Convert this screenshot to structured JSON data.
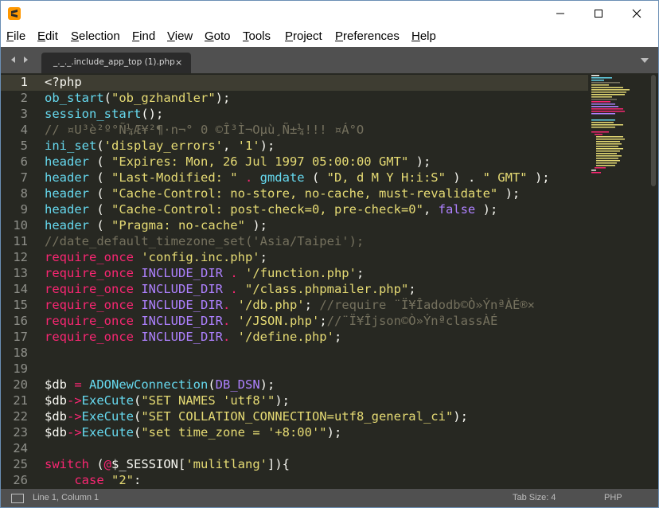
{
  "titlebar": {
    "icon": "sublime-text-icon",
    "controls": [
      "minimize-icon",
      "maximize-icon",
      "close-icon"
    ]
  },
  "menu": [
    "File",
    "Edit",
    "Selection",
    "Find",
    "View",
    "Goto",
    "Tools",
    "Project",
    "Preferences",
    "Help"
  ],
  "tab": {
    "label": "_._._.include_app_top (1).php",
    "close": "×"
  },
  "editor": {
    "line_numbers": [
      "1",
      "2",
      "3",
      "4",
      "5",
      "6",
      "7",
      "8",
      "9",
      "10",
      "11",
      "12",
      "13",
      "14",
      "15",
      "16",
      "17",
      "18",
      "19",
      "20",
      "21",
      "22",
      "23",
      "24",
      "25",
      "26"
    ],
    "current_line": 1,
    "code": {
      "l1": [
        "<?php"
      ],
      "l2": [
        "ob_start",
        "(",
        "\"ob_gzhandler\"",
        ");"
      ],
      "l3": [
        "session_start",
        "();"
      ],
      "l4": [
        "// ¤U³è²º°Ñ¼Æ¥²¶·­n¬° 0 ©Î³Ì¬Oµù¸Ñ±¼!!! ¤Á°O"
      ],
      "l5": [
        "ini_set",
        "(",
        "'display_errors'",
        ", ",
        "'1'",
        ");"
      ],
      "l6": [
        "header",
        " ( ",
        "\"Expires: Mon, 26 Jul 1997 05:00:00 GMT\"",
        " );"
      ],
      "l7": [
        "header",
        " ( ",
        "\"Last-Modified: \"",
        " . ",
        "gmdate",
        " ( ",
        "\"D, d M Y H:i:S\"",
        " ) . ",
        "\" GMT\"",
        " );"
      ],
      "l8": [
        "header",
        " ( ",
        "\"Cache-Control: no-store, no-cache, must-revalidate\"",
        " );"
      ],
      "l9": [
        "header",
        " ( ",
        "\"Cache-Control: post-check=0, pre-check=0\"",
        ", ",
        "false",
        " );"
      ],
      "l10": [
        "header",
        " ( ",
        "\"Pragma: no-cache\"",
        " );"
      ],
      "l11": [
        "//date_default_timezone_set('Asia/Taipei');"
      ],
      "l12": [
        "require_once",
        " ",
        "'config.inc.php'",
        ";"
      ],
      "l13": [
        "require_once",
        " ",
        "INCLUDE_DIR",
        " . ",
        "'/function.php'",
        ";"
      ],
      "l14": [
        "require_once",
        " ",
        "INCLUDE_DIR",
        " . ",
        "\"/class.phpmailer.php\"",
        ";"
      ],
      "l15": [
        "require_once",
        " ",
        "INCLUDE_DIR",
        ". ",
        "'/db.php'",
        "; ",
        "//require ¨Ï¥Îadodb©Ò»Ý­nªÀÉ®×"
      ],
      "l16": [
        "require_once",
        " ",
        "INCLUDE_DIR",
        ". ",
        "'/JSON.php'",
        ";",
        "//¨Ï¥Îjson©Ò»Ý­nªclassÀÉ"
      ],
      "l17": [
        "require_once",
        " ",
        "INCLUDE_DIR",
        ". ",
        "'/define.php'",
        ";"
      ],
      "l20": [
        "$db",
        " = ",
        "ADONewConnection",
        "(",
        "DB_DSN",
        ");"
      ],
      "l21": [
        "$db",
        "->",
        "ExeCute",
        "(",
        "\"SET NAMES 'utf8'\"",
        ");"
      ],
      "l22": [
        "$db",
        "->",
        "ExeCute",
        "(",
        "\"SET COLLATION_CONNECTION=utf8_general_ci\"",
        ");"
      ],
      "l23": [
        "$db",
        "->",
        "ExeCute",
        "(",
        "\"set time_zone = '+8:00'\"",
        ");"
      ],
      "l25": [
        "switch",
        " (",
        "@",
        "$_SESSION[",
        "'mulitlang'",
        "]){"
      ],
      "l26": [
        "    ",
        "case",
        " ",
        "\"2\"",
        ":"
      ]
    }
  },
  "status": {
    "position": "Line 1, Column 1",
    "tab_size": "Tab Size: 4",
    "syntax": "PHP"
  },
  "colors": {
    "editor_bg": "#272822",
    "keyword": "#f92672",
    "function": "#66d9ef",
    "string": "#e6db74",
    "comment": "#75715e",
    "constant": "#ae81ff",
    "chrome": "#505050"
  }
}
